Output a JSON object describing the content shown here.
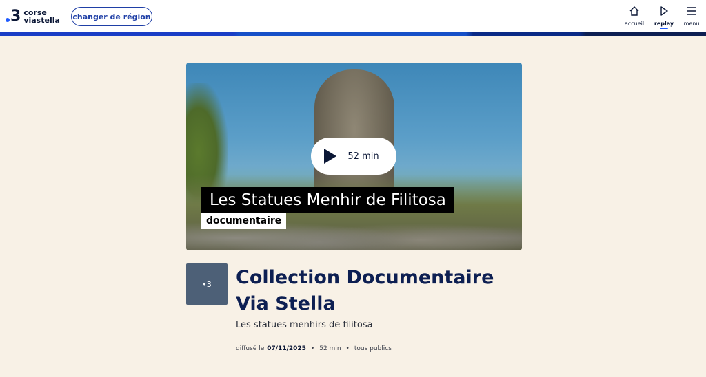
{
  "header": {
    "logo": {
      "number": "3",
      "line1": "corse",
      "line2": "viastella"
    },
    "region_button": "changer de région",
    "nav": [
      {
        "label": "accueil",
        "icon": "home-icon"
      },
      {
        "label": "replay",
        "icon": "play-icon",
        "active": true
      },
      {
        "label": "menu",
        "icon": "menu-icon"
      }
    ],
    "accent_colors": [
      "#1a3ec6",
      "#1650c8",
      "#0a2a86",
      "#0d1f52"
    ]
  },
  "video": {
    "duration": "52 min",
    "title": "Les Statues Menhir de Filitosa",
    "subtitle": "documentaire"
  },
  "program": {
    "thumb_label": "•3",
    "title": "Collection Documentaire Via Stella",
    "subtitle": "Les statues menhirs de filitosa",
    "meta": {
      "broadcast_prefix": "diffusé le",
      "date": "07/11/2025",
      "duration": "52 min",
      "audience": "tous publics",
      "separator": "•"
    }
  }
}
